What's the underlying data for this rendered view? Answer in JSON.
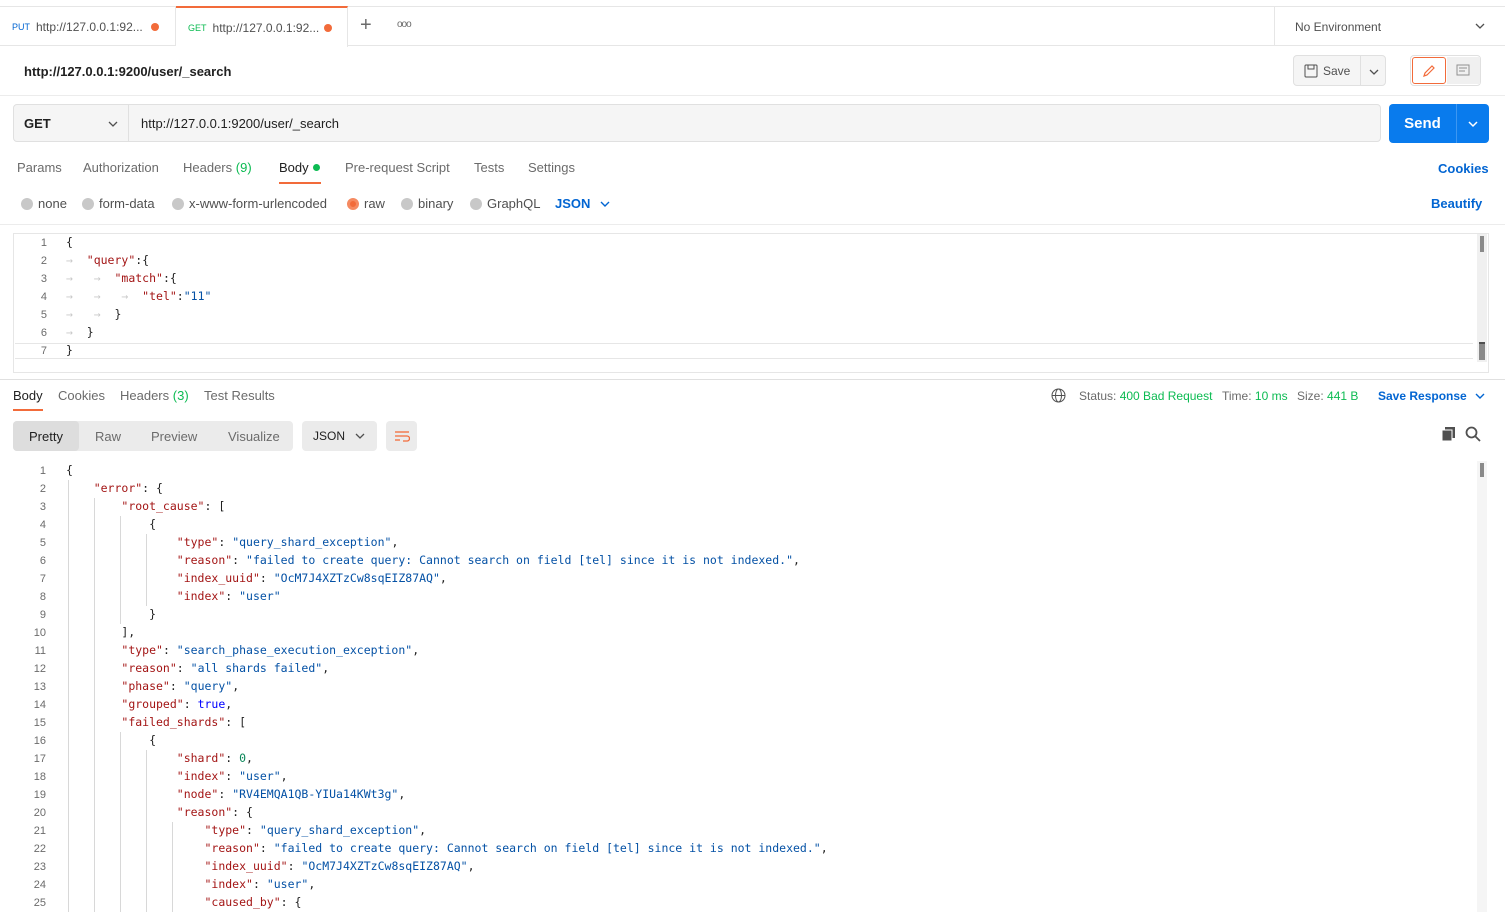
{
  "tabs": [
    {
      "method": "PUT",
      "title": "http://127.0.0.1:92..."
    },
    {
      "method": "GET",
      "title": "http://127.0.0.1:92..."
    }
  ],
  "tab_actions": {
    "new": "+",
    "more": "ooo"
  },
  "environment": "No Environment",
  "request_title": "http://127.0.0.1:9200/user/_search",
  "save_label": "Save",
  "method": "GET",
  "url": "http://127.0.0.1:9200/user/_search",
  "send_label": "Send",
  "request_tabs": [
    "Params",
    "Authorization",
    "Headers",
    "(9)",
    "Body",
    "Pre-request Script",
    "Tests",
    "Settings"
  ],
  "cookies_label": "Cookies",
  "body_types": [
    "none",
    "form-data",
    "x-www-form-urlencoded",
    "raw",
    "binary",
    "GraphQL"
  ],
  "body_format": "JSON",
  "beautify_label": "Beautify",
  "request_line_numbers": [
    "1",
    "2",
    "3",
    "4",
    "5",
    "6",
    "7"
  ],
  "response_tabs": [
    "Body",
    "Cookies",
    "Headers",
    "(3)",
    "Test Results"
  ],
  "status": {
    "status_label": "Status:",
    "status_value": "400 Bad Request",
    "time_label": "Time:",
    "time_value": "10 ms",
    "size_label": "Size:",
    "size_value": "441 B"
  },
  "save_response_label": "Save Response",
  "view_modes": [
    "Pretty",
    "Raw",
    "Preview",
    "Visualize"
  ],
  "response_format": "JSON",
  "response_line_numbers": [
    "1",
    "2",
    "3",
    "4",
    "5",
    "6",
    "7",
    "8",
    "9",
    "10",
    "11",
    "12",
    "13",
    "14",
    "15",
    "16",
    "17",
    "18",
    "19",
    "20",
    "21",
    "22",
    "23",
    "24",
    "25"
  ],
  "accent_colors": {
    "primary": "#097bed",
    "orange": "#f26b3a",
    "status_green": "#0cbb52",
    "link": "#0265d2"
  }
}
